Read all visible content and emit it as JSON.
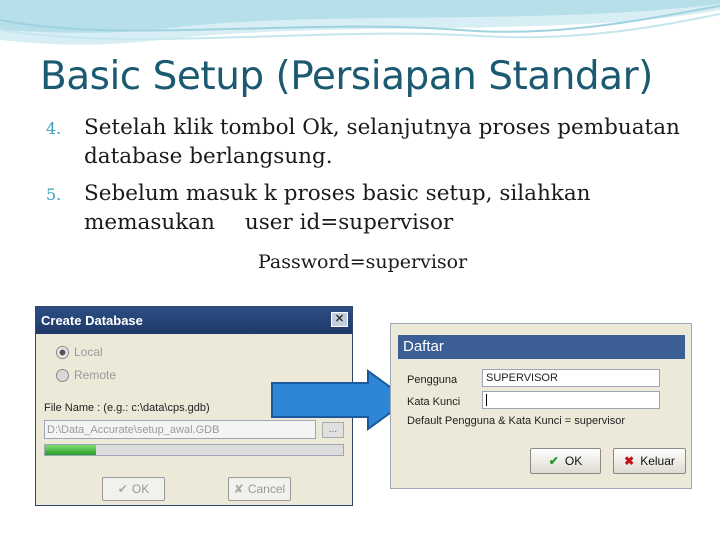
{
  "slide": {
    "title": "Basic Setup (Persiapan Standar)",
    "bullets": [
      {
        "num": "4.",
        "text": "Setelah klik tombol Ok, selanjutnya proses pembuatan database berlangsung."
      },
      {
        "num": "5.",
        "text_a": "Sebelum masuk k proses basic setup, silahkan memasukan",
        "text_b": "user id=supervisor"
      }
    ],
    "password_line": "Password=supervisor",
    "accent_color": "#1c5a72"
  },
  "create_db": {
    "title": "Create Database",
    "close_glyph": "✕",
    "radio_local": "Local",
    "radio_remote": "Remote",
    "file_name_label": "File Name :  (e.g.: c:\\data\\cps.gdb)",
    "path_value": "D:\\Data_Accurate\\setup_awal.GDB",
    "browse_label": "...",
    "progress_fraction": 0.17,
    "ok_label": "OK",
    "cancel_label": "Cancel"
  },
  "daftar": {
    "title": "Daftar",
    "user_label": "Pengguna",
    "user_value": "SUPERVISOR",
    "password_label": "Kata Kunci",
    "password_value": "",
    "note": "Default Pengguna & Kata Kunci = supervisor",
    "ok_label": "OK",
    "exit_label": "Keluar"
  }
}
